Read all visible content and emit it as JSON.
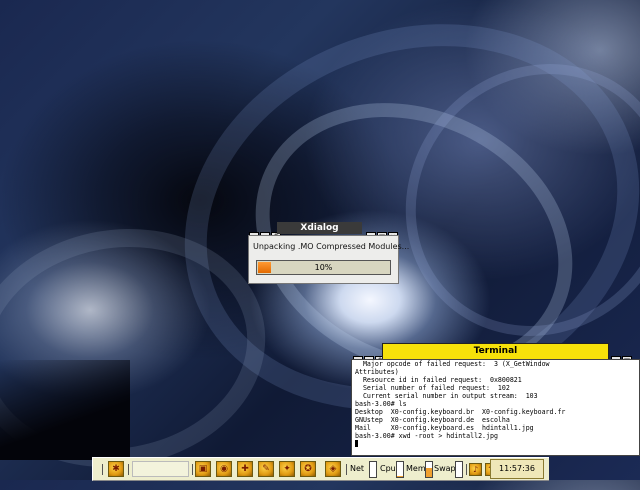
{
  "xdialog": {
    "title": "Xdialog",
    "message": "Unpacking .MO Compressed Modules...",
    "progress_text": "10%",
    "progress_fraction": 0.1
  },
  "terminal": {
    "title": "Terminal",
    "lines": [
      "  Major opcode of failed request:  3 (X_GetWindow",
      "Attributes)",
      "  Resource id in failed request:  0x800821",
      "  Serial number of failed request:  102",
      "  Current serial number in output stream:  103",
      "bash-3.00# ls",
      "Desktop  X0-config.keyboard.br  X0-config.keyboard.fr",
      "GNUstep  X0-config.keyboard.de  escolha",
      "Mail     X0-config.keyboard.es  hdintall1.jpg",
      "bash-3.00# xwd -root > hdintall2.jpg"
    ]
  },
  "taskbar": {
    "net_label": "Net",
    "cpu_label": "Cpu",
    "mem_label": "Mem",
    "swap_label": "Swap",
    "cpu_level": 0.1,
    "mem_level": 0.6,
    "swap_level": 0.0,
    "clock": "11:57:36"
  },
  "colors": {
    "terminal_title_bg": "#f7e20a",
    "xdialog_title_bg": "#3a3a3a",
    "progress_fill": "#ff8a10",
    "taskbar_bg": "#eeeecd"
  },
  "icons": {
    "launchers": [
      "start-menu-icon",
      "terminal-icon",
      "browser-icon",
      "file-manager-icon",
      "editor-icon",
      "settings-icon",
      "help-icon",
      "mail-icon"
    ],
    "tray": [
      "volume-icon",
      "network-icon"
    ]
  }
}
